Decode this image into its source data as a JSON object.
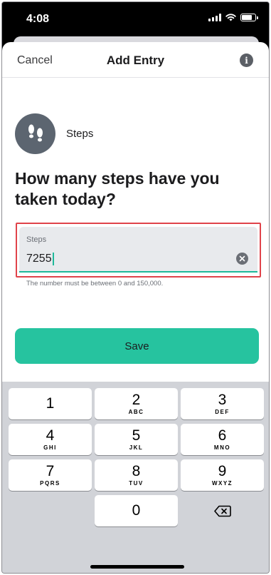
{
  "status_bar": {
    "time": "4:08",
    "battery_level": 0.8
  },
  "nav": {
    "cancel_label": "Cancel",
    "title": "Add Entry",
    "info_glyph": "i"
  },
  "metric": {
    "label": "Steps",
    "icon": "footprints-icon"
  },
  "question": "How many steps have you taken today?",
  "field": {
    "label": "Steps",
    "value": "7255",
    "helper": "The number must be between 0 and 150,000."
  },
  "save_label": "Save",
  "colors": {
    "accent": "#26c39f",
    "underline": "#1fb99a",
    "highlight": "#e0434a",
    "avatar": "#5c6570"
  },
  "keyboard": {
    "keys": [
      {
        "num": "1",
        "sub": ""
      },
      {
        "num": "2",
        "sub": "ABC"
      },
      {
        "num": "3",
        "sub": "DEF"
      },
      {
        "num": "4",
        "sub": "GHI"
      },
      {
        "num": "5",
        "sub": "JKL"
      },
      {
        "num": "6",
        "sub": "MNO"
      },
      {
        "num": "7",
        "sub": "PQRS"
      },
      {
        "num": "8",
        "sub": "TUV"
      },
      {
        "num": "9",
        "sub": "WXYZ"
      },
      {
        "num": "0",
        "sub": ""
      }
    ]
  }
}
